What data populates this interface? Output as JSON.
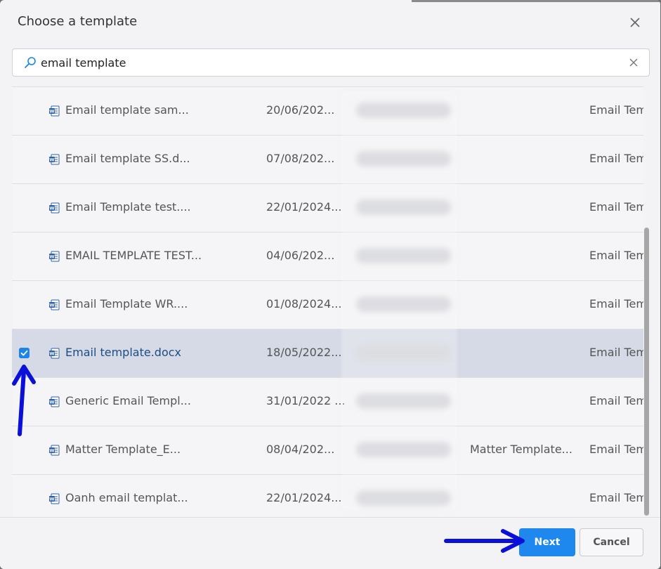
{
  "dialog": {
    "title": "Choose a template",
    "close_icon": "close-icon"
  },
  "search": {
    "value": "email template",
    "icon": "search-icon",
    "clear_icon": "clear-icon"
  },
  "rows": [
    {
      "name": "Email template sam...",
      "date": "20/06/202...",
      "category": "",
      "type": "Email Tem",
      "checked": false
    },
    {
      "name": "Email template SS.d...",
      "date": "07/08/202...",
      "category": "",
      "type": "Email Tem",
      "checked": false
    },
    {
      "name": "Email Template test....",
      "date": "22/01/2024...",
      "category": "",
      "type": "Email Tem",
      "checked": false
    },
    {
      "name": "EMAIL TEMPLATE TEST...",
      "date": "04/06/202...",
      "category": "",
      "type": "Email Tem",
      "checked": false
    },
    {
      "name": "Email Template WR....",
      "date": "01/08/2024...",
      "category": "",
      "type": "Email Tem",
      "checked": false
    },
    {
      "name": "Email template.docx",
      "date": "18/05/2022...",
      "category": "",
      "type": "Email Tem",
      "checked": true
    },
    {
      "name": "Generic Email Templ...",
      "date": "31/01/2022 ...",
      "category": "",
      "type": "Email Tem",
      "checked": false
    },
    {
      "name": "Matter Template_E...",
      "date": "08/04/202...",
      "category": "Matter Template...",
      "type": "Email Tem",
      "checked": false
    },
    {
      "name": "Oanh email templat...",
      "date": "22/01/2024...",
      "category": "",
      "type": "Email Tem",
      "checked": false
    }
  ],
  "footer": {
    "next_label": "Next",
    "cancel_label": "Cancel"
  },
  "colors": {
    "accent": "#1e88ee",
    "selected_row": "#d6d9e6",
    "annotation_arrow": "#0a10d8"
  }
}
